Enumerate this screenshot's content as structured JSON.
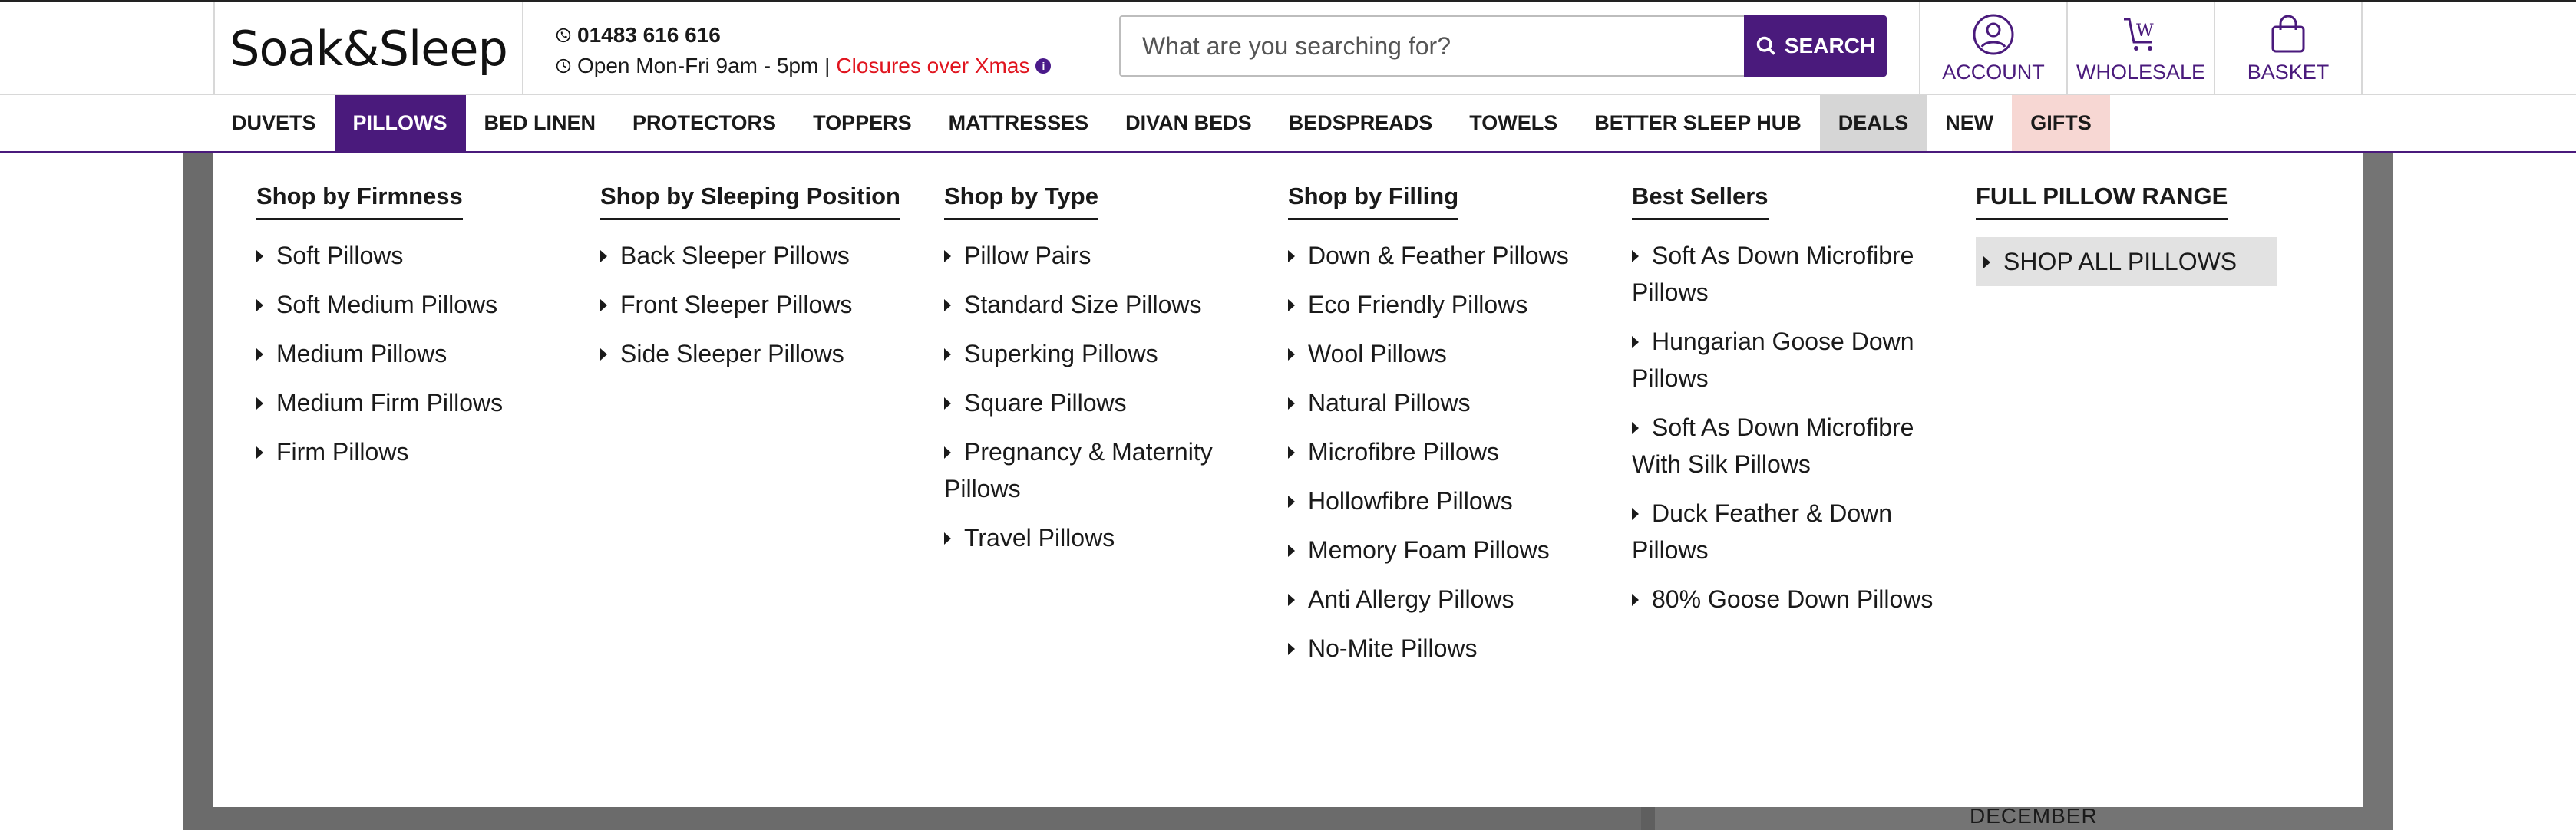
{
  "header": {
    "logo": "Soak&Sleep",
    "phone": "01483 616 616",
    "hours": "Open Mon-Fri 9am - 5pm |",
    "closures": "Closures over Xmas",
    "search_placeholder": "What are you searching for?",
    "search_button": "SEARCH",
    "actions": [
      {
        "label": "ACCOUNT",
        "icon": "user-icon"
      },
      {
        "label": "WHOLESALE",
        "icon": "wholesale-icon"
      },
      {
        "label": "BASKET",
        "icon": "basket-icon"
      }
    ]
  },
  "nav": [
    {
      "label": "DUVETS"
    },
    {
      "label": "PILLOWS"
    },
    {
      "label": "BED LINEN"
    },
    {
      "label": "PROTECTORS"
    },
    {
      "label": "TOPPERS"
    },
    {
      "label": "MATTRESSES"
    },
    {
      "label": "DIVAN BEDS"
    },
    {
      "label": "BEDSPREADS"
    },
    {
      "label": "TOWELS"
    },
    {
      "label": "BETTER SLEEP HUB"
    },
    {
      "label": "DEALS"
    },
    {
      "label": "NEW"
    },
    {
      "label": "GIFTS"
    }
  ],
  "mega_menu": {
    "columns": [
      {
        "title": "Shop by Firmness",
        "items": [
          "Soft Pillows",
          "Soft Medium Pillows",
          "Medium Pillows",
          "Medium Firm Pillows",
          "Firm Pillows"
        ]
      },
      {
        "title": "Shop by Sleeping Position",
        "items": [
          "Back Sleeper Pillows",
          "Front Sleeper Pillows",
          "Side Sleeper Pillows"
        ]
      },
      {
        "title": "Shop by Type",
        "items": [
          "Pillow Pairs",
          "Standard Size Pillows",
          "Superking Pillows",
          "Square Pillows",
          "Pregnancy & Maternity Pillows",
          "Travel Pillows"
        ]
      },
      {
        "title": "Shop by Filling",
        "items": [
          "Down & Feather Pillows",
          "Eco Friendly Pillows",
          "Wool Pillows",
          "Natural Pillows",
          "Microfibre Pillows",
          "Hollowfibre Pillows",
          "Memory Foam Pillows",
          "Anti Allergy Pillows",
          "No-Mite Pillows"
        ]
      },
      {
        "title": "Best Sellers",
        "items": [
          "Soft As Down Microfibre Pillows",
          "Hungarian Goose Down Pillows",
          "Soft As Down Microfibre With Silk Pillows",
          "Duck Feather & Down Pillows",
          "80% Goose Down Pillows"
        ]
      },
      {
        "title": "FULL PILLOW RANGE",
        "items": [
          "SHOP ALL PILLOWS"
        ]
      }
    ]
  },
  "background": {
    "december_label": "DECEMBER"
  },
  "colors": {
    "brand_purple": "#4a1a7c",
    "alert_red": "#e0141e",
    "deals_bg": "#d6d6d6",
    "gifts_bg": "#f7d7d3"
  }
}
